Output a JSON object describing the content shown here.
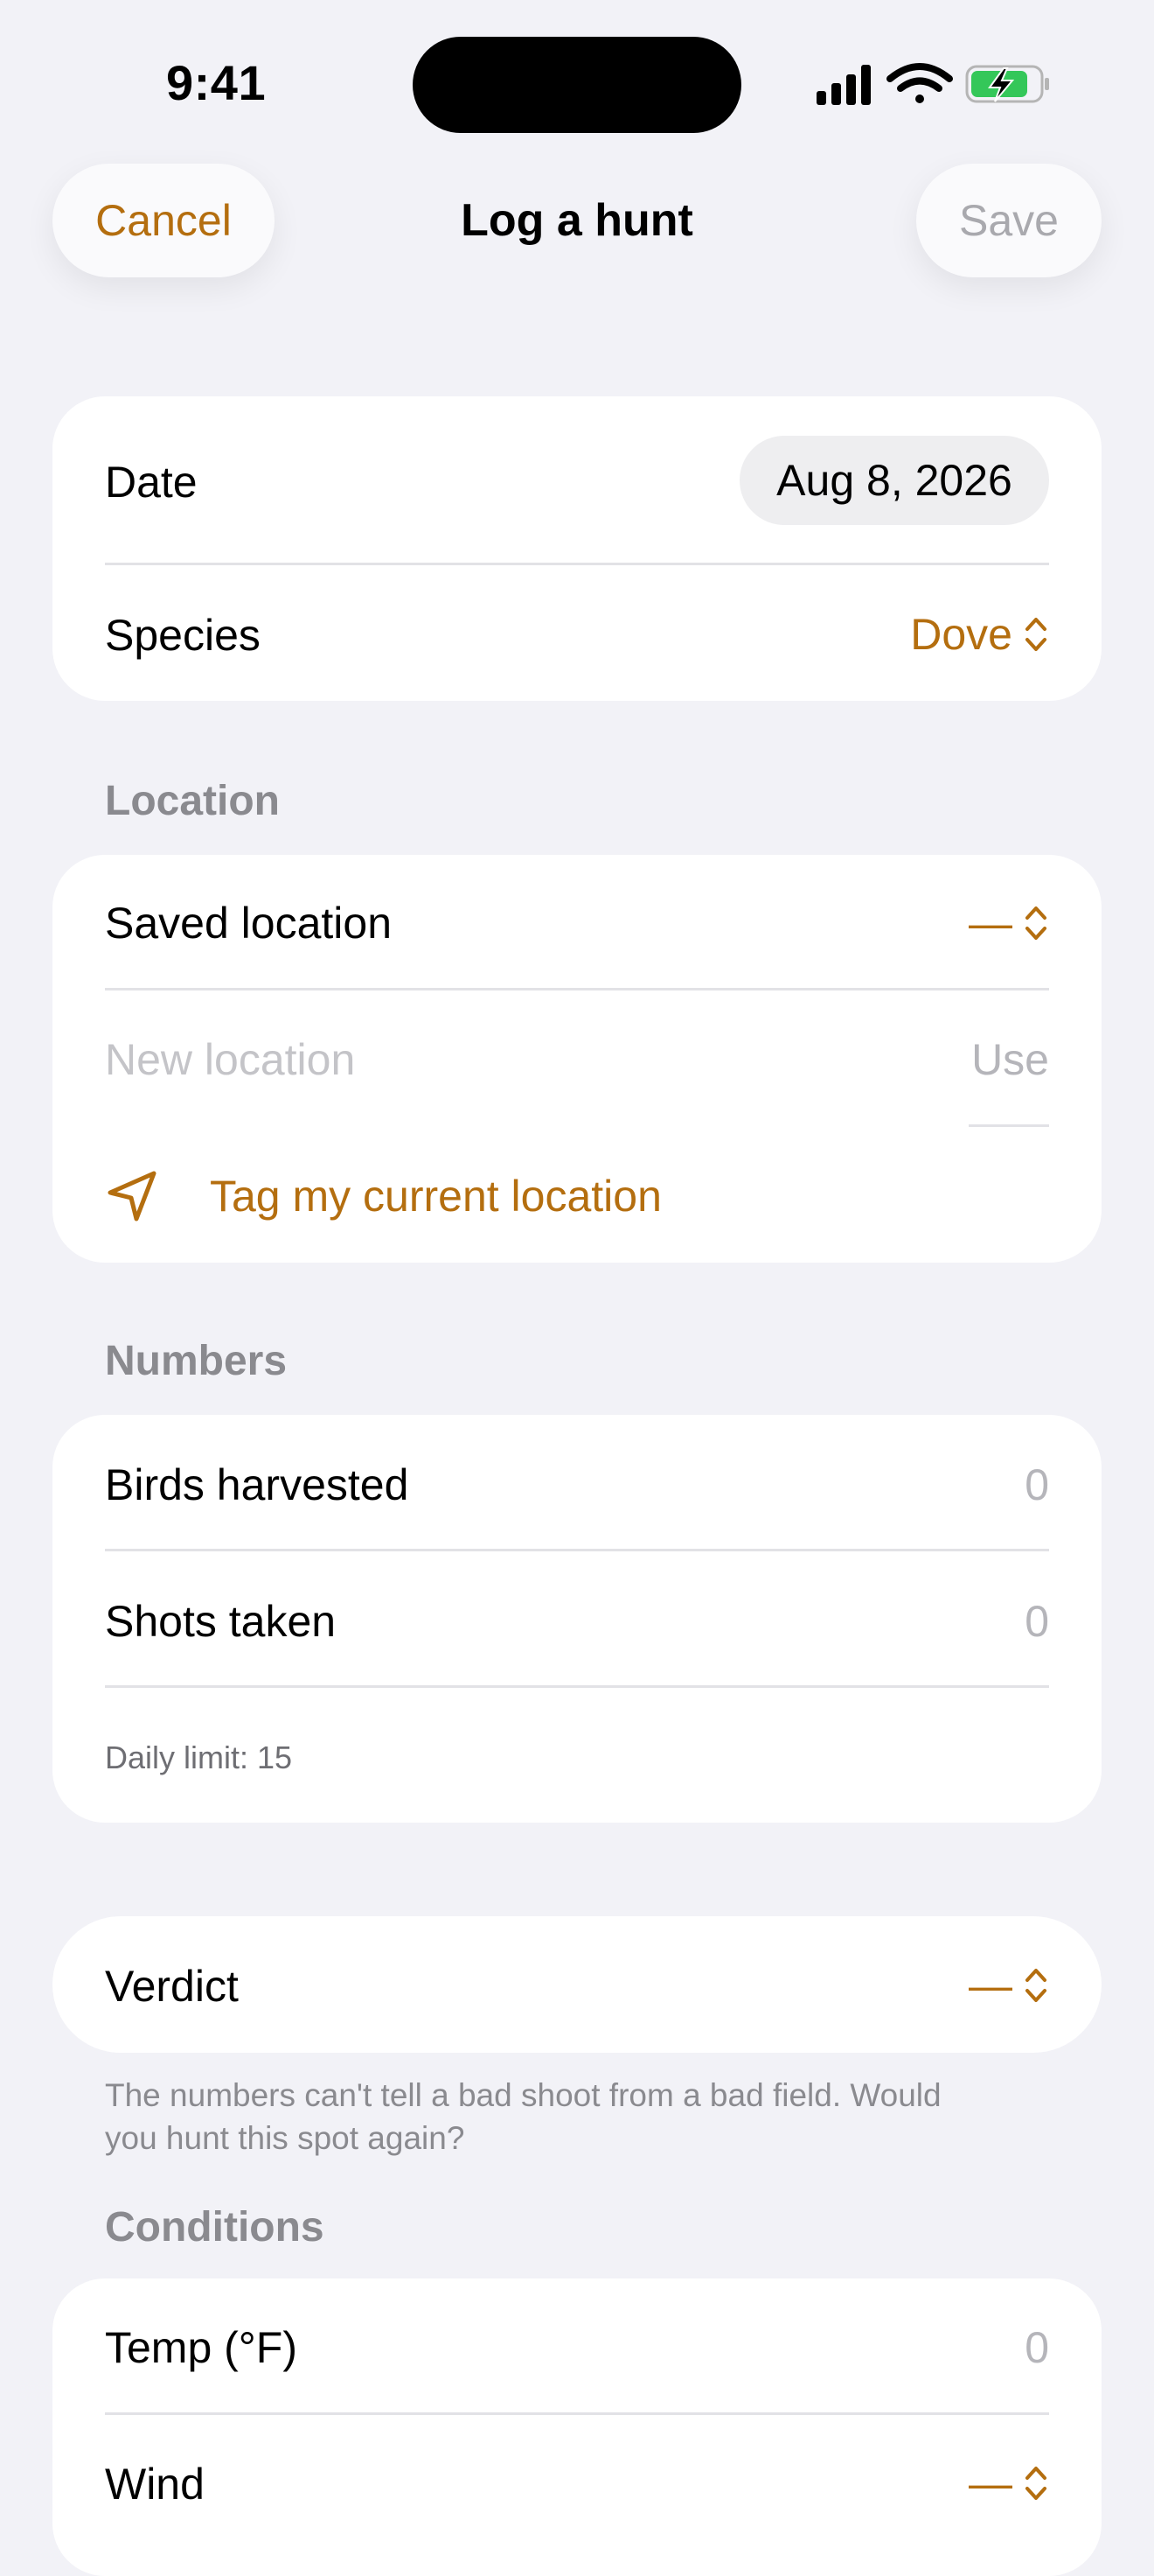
{
  "status_bar": {
    "time": "9:41"
  },
  "nav": {
    "cancel": "Cancel",
    "title": "Log a hunt",
    "save": "Save"
  },
  "date_row": {
    "label": "Date",
    "value": "Aug 8, 2026"
  },
  "species_row": {
    "label": "Species",
    "value": "Dove"
  },
  "location": {
    "header": "Location",
    "saved_label": "Saved location",
    "saved_value": "—",
    "new_placeholder": "New location",
    "use_label": "Use",
    "tag_label": "Tag my current location"
  },
  "numbers": {
    "header": "Numbers",
    "birds_label": "Birds harvested",
    "birds_value": "0",
    "shots_label": "Shots taken",
    "shots_value": "0",
    "limit_note": "Daily limit: 15"
  },
  "verdict": {
    "label": "Verdict",
    "value": "—",
    "note_line1": "The numbers can't tell a bad shoot from a bad field. Would",
    "note_line2": "you hunt this spot again?"
  },
  "conditions": {
    "header": "Conditions",
    "temp_label": "Temp (°F)",
    "temp_value": "0",
    "wind_label": "Wind",
    "wind_value": "—"
  },
  "colors": {
    "accent": "#b46e0f",
    "background": "#f2f2f7",
    "card": "#ffffff",
    "muted": "#8a8a8f"
  },
  "icons": [
    "cellular-signal-icon",
    "wifi-icon",
    "battery-charging-icon",
    "chevron-up-down-icon",
    "location-arrow-icon"
  ]
}
